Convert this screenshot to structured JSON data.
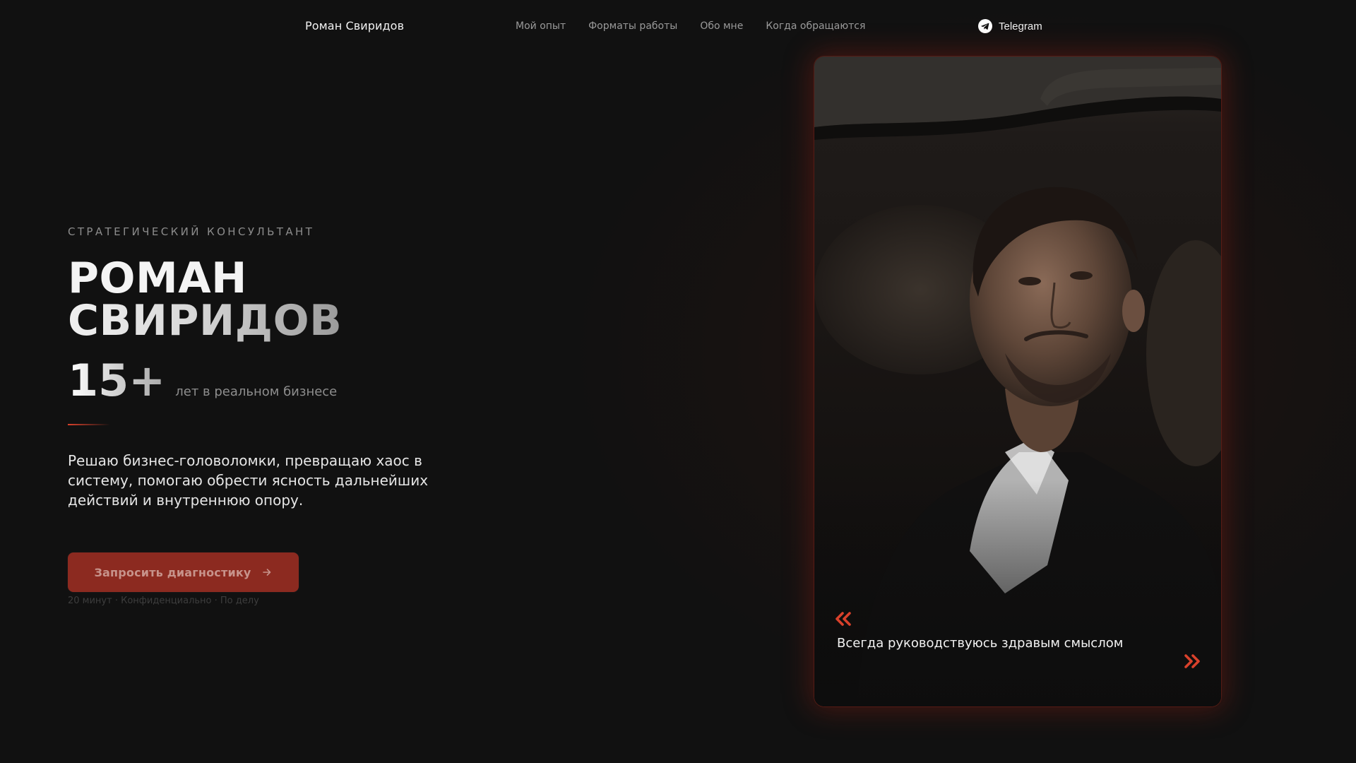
{
  "brand": {
    "name": "Роман Свиридов"
  },
  "nav": {
    "items": [
      {
        "label": "Мой опыт"
      },
      {
        "label": "Форматы работы"
      },
      {
        "label": "Обо мне"
      },
      {
        "label": "Когда обращаются"
      }
    ],
    "telegram": {
      "label": "Telegram",
      "icon": "telegram-icon"
    }
  },
  "hero": {
    "eyebrow": "СТРАТЕГИЧЕСКИЙ КОНСУЛЬТАНТ",
    "title_line_1": "РОМАН",
    "title_line_2": "СВИРИДОВ",
    "stat_value": "15+",
    "stat_label": "лет в реальном бизнесе",
    "description": "Решаю бизнес-головоломки, превращаю хаос в систему, помогаю обрести ясность дальнейших действий и внутреннюю опору.",
    "cta": {
      "label": "Запросить диагностику",
      "icon": "arrow-right-icon"
    },
    "cta_note": "20 минут · Конфиденциально · По делу"
  },
  "photo_card": {
    "image": "portrait-photo",
    "quote": "Всегда руководствуюсь здравым смыслом",
    "quote_open_icon": "double-chevron-left-icon",
    "quote_close_icon": "double-chevron-right-icon"
  },
  "colors": {
    "background": "#111111",
    "accent": "#d9412b",
    "button": "#8c2a20",
    "muted_text": "#8c8c8c"
  }
}
